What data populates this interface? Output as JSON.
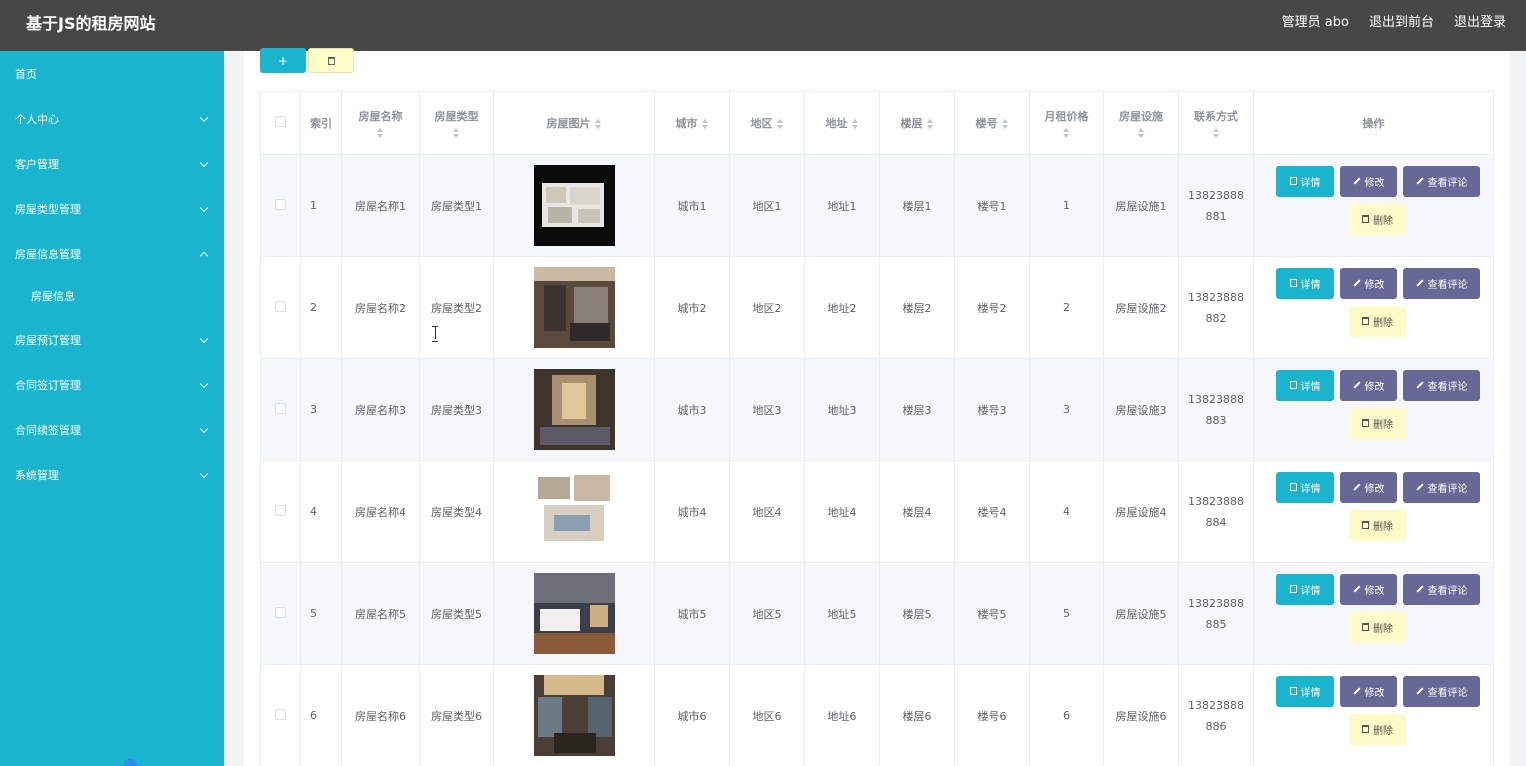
{
  "header": {
    "brand": "基于JS的租房网站",
    "admin": "管理员 abo",
    "to_front": "退出到前台",
    "logout": "退出登录"
  },
  "sidebar": {
    "items": [
      {
        "label": "首页",
        "arrow": ""
      },
      {
        "label": "个人中心",
        "arrow": "down"
      },
      {
        "label": "客户管理",
        "arrow": "down"
      },
      {
        "label": "房屋类型管理",
        "arrow": "down"
      },
      {
        "label": "房屋信息管理",
        "arrow": "up"
      },
      {
        "label": "房屋信息",
        "arrow": "",
        "sub": true
      },
      {
        "label": "房屋预订管理",
        "arrow": "down"
      },
      {
        "label": "合同签订管理",
        "arrow": "down"
      },
      {
        "label": "合同续签管理",
        "arrow": "down"
      },
      {
        "label": "系统管理",
        "arrow": "down"
      }
    ]
  },
  "toolbar": {
    "add_label": "+"
  },
  "table": {
    "columns": [
      "索引",
      "房屋名称",
      "房屋类型",
      "房屋图片",
      "城市",
      "地区",
      "地址",
      "楼层",
      "楼号",
      "月租价格",
      "房屋设施",
      "联系方式",
      "操作"
    ],
    "actions": {
      "detail": "详情",
      "edit": "修改",
      "review": "查看评论",
      "delete": "删除"
    },
    "rows": [
      {
        "index": "1",
        "name": "房屋名称1",
        "type": "房屋类型1",
        "image": "room-floorplan",
        "city": "城市1",
        "district": "地区1",
        "address": "地址1",
        "floor": "楼层1",
        "building": "楼号1",
        "price": "1",
        "facility": "房屋设施1",
        "contact_line1": "13823888",
        "contact_line2": "881"
      },
      {
        "index": "2",
        "name": "房屋名称2",
        "type": "房屋类型2",
        "image": "room-bedroom",
        "city": "城市2",
        "district": "地区2",
        "address": "地址2",
        "floor": "楼层2",
        "building": "楼号2",
        "price": "2",
        "facility": "房屋设施2",
        "contact_line1": "13823888",
        "contact_line2": "882"
      },
      {
        "index": "3",
        "name": "房屋名称3",
        "type": "房屋类型3",
        "image": "room-living",
        "city": "城市3",
        "district": "地区3",
        "address": "地址3",
        "floor": "楼层3",
        "building": "楼号3",
        "price": "3",
        "facility": "房屋设施3",
        "contact_line1": "13823888",
        "contact_line2": "883"
      },
      {
        "index": "4",
        "name": "房屋名称4",
        "type": "房屋类型4",
        "image": "room-design",
        "city": "城市4",
        "district": "地区4",
        "address": "地址4",
        "floor": "楼层4",
        "building": "楼号4",
        "price": "4",
        "facility": "房屋设施4",
        "contact_line1": "13823888",
        "contact_line2": "884"
      },
      {
        "index": "5",
        "name": "房屋名称5",
        "type": "房屋类型5",
        "image": "room-hotel",
        "city": "城市5",
        "district": "地区5",
        "address": "地址5",
        "floor": "楼层5",
        "building": "楼号5",
        "price": "5",
        "facility": "房屋设施5",
        "contact_line1": "13823888",
        "contact_line2": "885"
      },
      {
        "index": "6",
        "name": "房屋名称6",
        "type": "房屋类型6",
        "image": "room-suite",
        "city": "城市6",
        "district": "地区6",
        "address": "地址6",
        "floor": "楼层6",
        "building": "楼号6",
        "price": "6",
        "facility": "房屋设施6",
        "contact_line1": "13823888",
        "contact_line2": "886"
      }
    ]
  },
  "colors": {
    "accent": "#1ab4cf",
    "topbar": "#474747",
    "button_purple": "#686896",
    "button_delete": "#fffac8"
  }
}
